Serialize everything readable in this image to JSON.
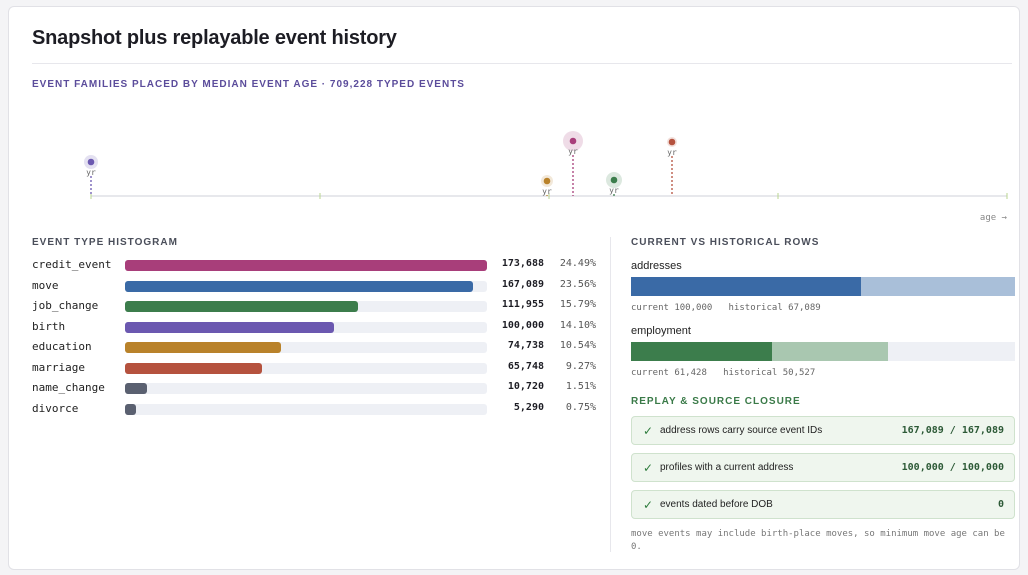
{
  "title": "Snapshot plus replayable event history",
  "timeline": {
    "heading": "EVENT FAMILIES PLACED BY MEDIAN EVENT AGE · 709,228 TYPED EVENTS",
    "axis_label": "age →",
    "marker_unit": "yr",
    "colors": [
      "#6b58b0",
      "#b9822a",
      "#a83e7a",
      "#3c7d4c",
      "#b5523e"
    ]
  },
  "histogram": {
    "heading": "EVENT TYPE HISTOGRAM",
    "rows": [
      {
        "name": "credit_event",
        "count": "173,688",
        "pct": "24.49%",
        "fraction": 1.0,
        "color": "#a83e7a"
      },
      {
        "name": "move",
        "count": "167,089",
        "pct": "23.56%",
        "fraction": 0.962,
        "color": "#3a6aa6"
      },
      {
        "name": "job_change",
        "count": "111,955",
        "pct": "15.79%",
        "fraction": 0.645,
        "color": "#3c7d4c"
      },
      {
        "name": "birth",
        "count": "100,000",
        "pct": "14.10%",
        "fraction": 0.576,
        "color": "#6b58b0"
      },
      {
        "name": "education",
        "count": "74,738",
        "pct": "10.54%",
        "fraction": 0.43,
        "color": "#b9822a"
      },
      {
        "name": "marriage",
        "count": "65,748",
        "pct": "9.27%",
        "fraction": 0.379,
        "color": "#b5523e"
      },
      {
        "name": "name_change",
        "count": "10,720",
        "pct": "1.51%",
        "fraction": 0.062,
        "color": "#5a6070"
      },
      {
        "name": "divorce",
        "count": "5,290",
        "pct": "0.75%",
        "fraction": 0.03,
        "color": "#5a6070"
      }
    ]
  },
  "current_vs_historical": {
    "heading": "CURRENT VS HISTORICAL ROWS",
    "items": [
      {
        "label": "addresses",
        "current_note": "current 100,000",
        "historical_note": "historical 67,089",
        "current_fraction": 0.598,
        "historical_fraction": 0.402,
        "current_color": "#3a6aa6",
        "historical_color": "#a9bfd9"
      },
      {
        "label": "employment",
        "current_note": "current 61,428",
        "historical_note": "historical 50,527",
        "current_fraction": 0.368,
        "historical_fraction": 0.302,
        "current_color": "#3c7d4c",
        "historical_color": "#a9c7b0"
      }
    ]
  },
  "replay": {
    "heading": "REPLAY & SOURCE CLOSURE",
    "checks": [
      {
        "text": "address rows carry source event IDs",
        "value": "167,089 / 167,089"
      },
      {
        "text": "profiles with a current address",
        "value": "100,000 / 100,000"
      },
      {
        "text": "events dated before DOB",
        "value": "0"
      }
    ],
    "footnote": "move events may include birth-place moves, so minimum move age can be 0."
  }
}
